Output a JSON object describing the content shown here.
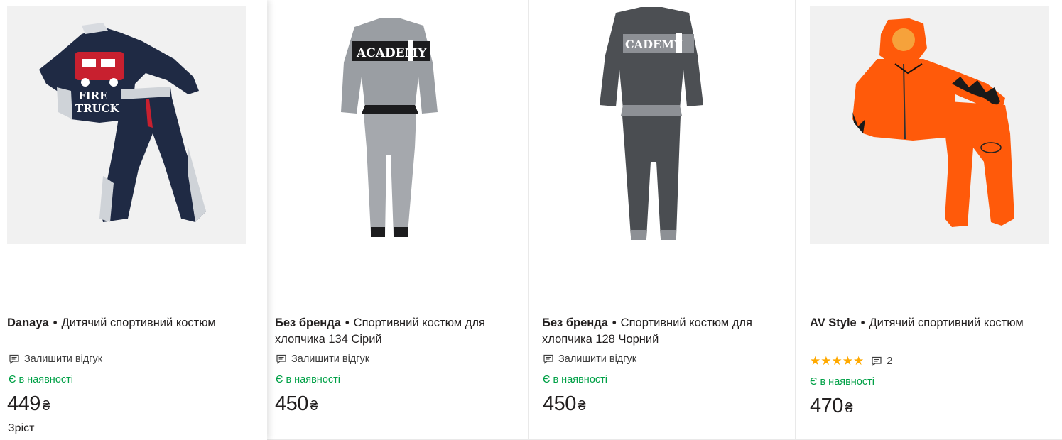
{
  "products": [
    {
      "brand": "Danaya",
      "separator": "•",
      "name": "Дитячий спортивний костюм",
      "review_label": "Залишити відгук",
      "stock": "Є в наявності",
      "price": "449",
      "currency": "₴",
      "extra_label": "Зріст",
      "image_icon": "tracksuit-image"
    },
    {
      "brand": "Без бренда",
      "separator": "•",
      "name": "Спортивний костюм для хлопчика 134 Сірий",
      "review_label": "Залишити відгук",
      "stock": "Є в наявності",
      "price": "450",
      "currency": "₴",
      "image_icon": "tracksuit-image"
    },
    {
      "brand": "Без бренда",
      "separator": "•",
      "name": "Спортивний костюм для хлопчика 128 Чорний",
      "review_label": "Залишити відгук",
      "stock": "Є в наявності",
      "price": "450",
      "currency": "₴",
      "image_icon": "tracksuit-image"
    },
    {
      "brand": "AV Style",
      "separator": "•",
      "name": "Дитячий спортивний костюм",
      "rating_stars": "★★★★★",
      "rating": 5,
      "reviews_count": "2",
      "stock": "Є в наявності",
      "price": "470",
      "currency": "₴",
      "image_icon": "tracksuit-image"
    }
  ],
  "colors": {
    "in_stock": "#00a046",
    "star": "#ffa900",
    "text": "#221f1f",
    "divider": "#e9e9e9"
  }
}
